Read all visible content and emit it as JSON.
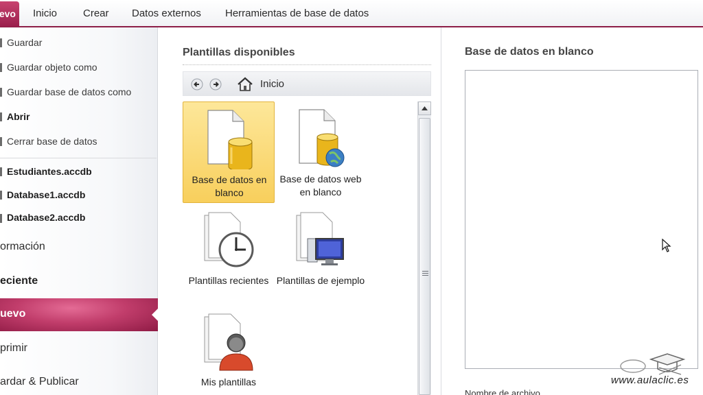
{
  "ribbon": {
    "file_tab": "uevo",
    "tabs": [
      "Inicio",
      "Crear",
      "Datos externos",
      "Herramientas de base de datos"
    ]
  },
  "backstage": {
    "commands": [
      {
        "label": "Guardar"
      },
      {
        "label": "Guardar objeto como"
      },
      {
        "label": "Guardar base de datos como"
      },
      {
        "label": "Abrir"
      },
      {
        "label": "Cerrar base de datos"
      }
    ],
    "recent_files": [
      "Estudiantes.accdb",
      "Database1.accdb",
      "Database2.accdb"
    ],
    "sections": {
      "informacion": "ormación",
      "reciente": "eciente",
      "nuevo": "uevo",
      "imprimir": "primir",
      "guardar_publicar": "ardar & Publicar"
    }
  },
  "center": {
    "title": "Plantillas disponibles",
    "nav_label": "Inicio",
    "templates": [
      {
        "label": "Base de datos en blanco",
        "selected": true
      },
      {
        "label": "Base de datos web en blanco",
        "selected": false
      },
      {
        "label": "Plantillas recientes",
        "selected": false
      },
      {
        "label": "Plantillas de ejemplo",
        "selected": false
      },
      {
        "label": "Mis plantillas",
        "selected": false
      }
    ]
  },
  "right": {
    "title": "Base de datos en blanco",
    "filename_label": "Nombre de archivo"
  },
  "watermark": "www.aulaclic.es",
  "colors": {
    "accent": "#9a1f4c",
    "selected_tile": "#f8cf5c",
    "nuevo_highlight": "#c13d6b"
  }
}
